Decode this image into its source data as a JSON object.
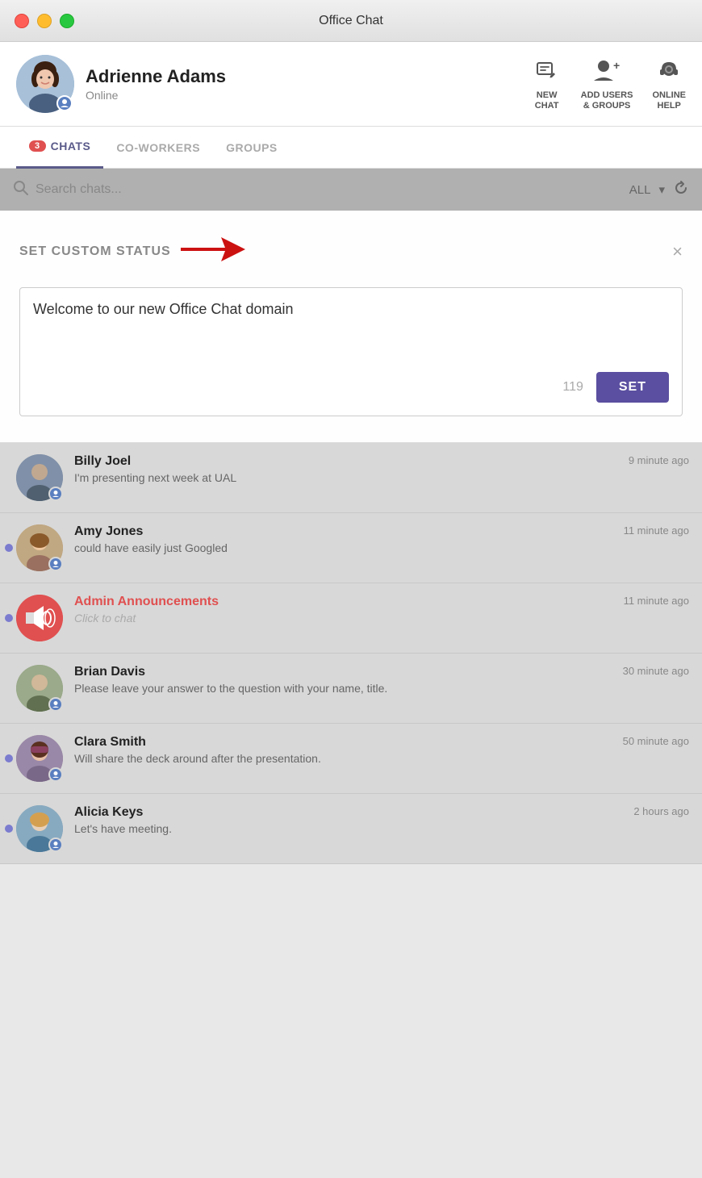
{
  "titleBar": {
    "title": "Office Chat"
  },
  "header": {
    "userName": "Adrienne Adams",
    "userStatus": "Online",
    "actions": [
      {
        "id": "new-chat",
        "icon": "edit-icon",
        "label": "NEW\nCHAT"
      },
      {
        "id": "add-users",
        "icon": "add-users-icon",
        "label": "ADD USERS\n& GROUPS"
      },
      {
        "id": "online-help",
        "icon": "headset-icon",
        "label": "ONLINE\nHELP"
      }
    ]
  },
  "tabs": {
    "items": [
      {
        "id": "chats",
        "label": "CHATS",
        "badge": "3",
        "active": true
      },
      {
        "id": "coworkers",
        "label": "CO-WORKERS",
        "active": false
      },
      {
        "id": "groups",
        "label": "GROUPS",
        "active": false
      }
    ]
  },
  "searchBar": {
    "placeholder": "Search chats...",
    "filterLabel": "ALL",
    "refreshIcon": "refresh-icon"
  },
  "customStatusModal": {
    "title": "SET CUSTOM STATUS",
    "closeLabel": "×",
    "inputValue": "Welcome to our new Office Chat domain",
    "charCount": "119",
    "setButtonLabel": "SET"
  },
  "chatList": {
    "items": [
      {
        "id": "billy-joel",
        "name": "Billy Joel",
        "preview": "I'm presenting next week at UAL",
        "time": "9 minute ago",
        "unread": false,
        "avatarClass": "av-billy",
        "isGroup": false
      },
      {
        "id": "amy-jones",
        "name": "Amy Jones",
        "preview": "could have easily just Googled",
        "time": "11 minute ago",
        "unread": true,
        "avatarClass": "av-amy",
        "isGroup": false
      },
      {
        "id": "admin-announcements",
        "name": "Admin Announcements",
        "preview": "Click to chat",
        "time": "11 minute ago",
        "unread": true,
        "avatarClass": "av-admin",
        "isGroup": true,
        "isClickToChat": true
      },
      {
        "id": "brian-davis",
        "name": "Brian Davis",
        "preview": "Please leave your answer to the question with your name, title.",
        "time": "30 minute ago",
        "unread": false,
        "avatarClass": "av-brian",
        "isGroup": false
      },
      {
        "id": "clara-smith",
        "name": "Clara Smith",
        "preview": "Will share the deck around after the presentation.",
        "time": "50 minute ago",
        "unread": true,
        "avatarClass": "av-clara",
        "isGroup": false
      },
      {
        "id": "alicia-keys",
        "name": "Alicia Keys",
        "preview": "Let's have meeting.",
        "time": "2 hours ago",
        "unread": true,
        "avatarClass": "av-alicia",
        "isGroup": false
      }
    ]
  }
}
